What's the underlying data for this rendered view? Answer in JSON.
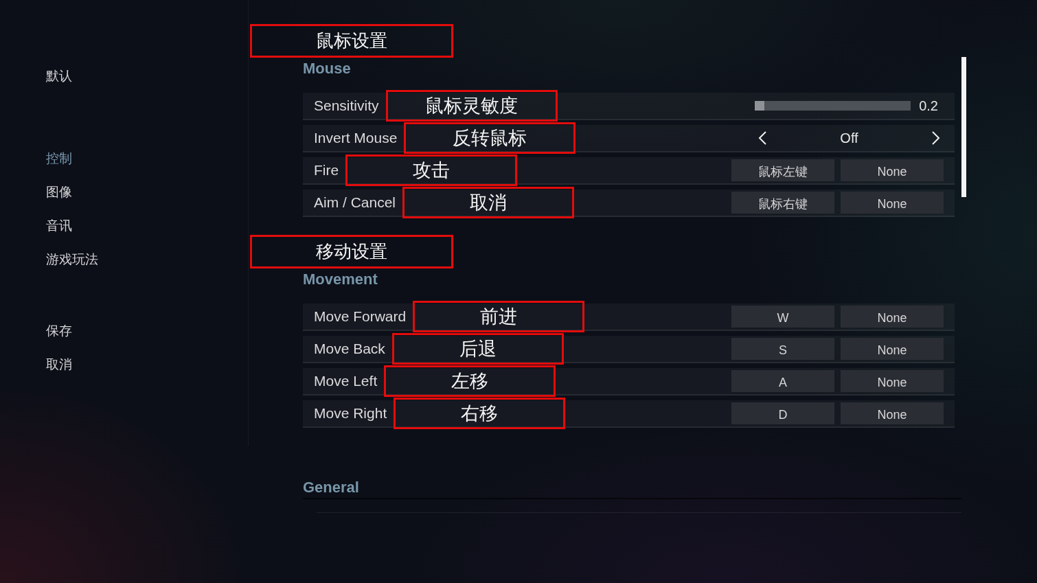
{
  "sidebar": {
    "top_actions": [
      "默认"
    ],
    "categories": [
      {
        "label": "控制",
        "selected": true
      },
      {
        "label": "图像",
        "selected": false
      },
      {
        "label": "音讯",
        "selected": false
      },
      {
        "label": "游戏玩法",
        "selected": false
      }
    ],
    "bottom_actions": [
      "保存",
      "取消"
    ]
  },
  "sections": [
    {
      "title": "Mouse",
      "annotation": "鼠标设置",
      "rows": [
        {
          "kind": "slider",
          "label": "Sensitivity",
          "annotation": "鼠标灵敏度",
          "level": 0.06,
          "reading": "0.2"
        },
        {
          "kind": "selector",
          "label": "Invert Mouse",
          "annotation": "反转鼠标",
          "value": "Off"
        },
        {
          "kind": "binding",
          "label": "Fire",
          "annotation": "攻击",
          "primary": "鼠标左键",
          "secondary": "None"
        },
        {
          "kind": "binding",
          "label": "Aim / Cancel",
          "annotation": "取消",
          "primary": "鼠标右键",
          "secondary": "None"
        }
      ]
    },
    {
      "title": "Movement",
      "annotation": "移动设置",
      "rows": [
        {
          "kind": "binding",
          "label": "Move Forward",
          "annotation": "前进",
          "primary": "W",
          "secondary": "None"
        },
        {
          "kind": "binding",
          "label": "Move Back",
          "annotation": "后退",
          "primary": "S",
          "secondary": "None"
        },
        {
          "kind": "binding",
          "label": "Move Left",
          "annotation": "左移",
          "primary": "A",
          "secondary": "None"
        },
        {
          "kind": "binding",
          "label": "Move Right",
          "annotation": "右移",
          "primary": "D",
          "secondary": "None"
        }
      ]
    },
    {
      "title": "General"
    }
  ]
}
